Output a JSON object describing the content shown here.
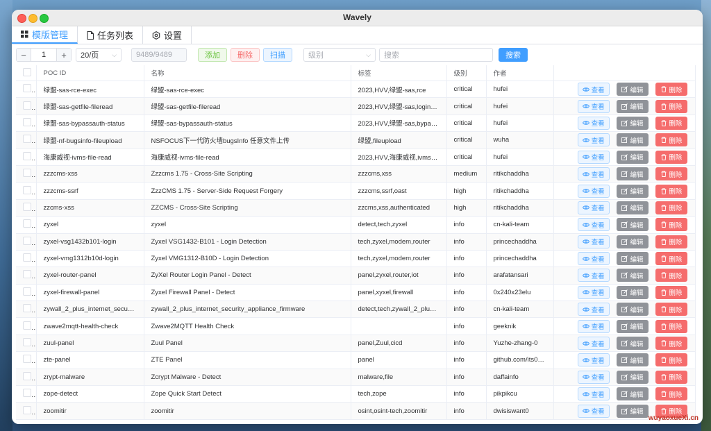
{
  "window": {
    "title": "Wavely"
  },
  "tabs": [
    {
      "label": "模版管理",
      "icon": "grid-icon"
    },
    {
      "label": "任务列表",
      "icon": "document-icon"
    },
    {
      "label": "设置",
      "icon": "gear-icon"
    }
  ],
  "toolbar": {
    "page_value": "1",
    "page_size": "20/页",
    "count_text": "9489/9489",
    "add_label": "添加",
    "delete_label": "删除",
    "scan_label": "扫描",
    "level_placeholder": "级别",
    "search_placeholder": "搜索",
    "search_label": "搜索"
  },
  "table": {
    "headers": [
      "POC ID",
      "名称",
      "标签",
      "级别",
      "作者"
    ],
    "actions": {
      "view": "查看",
      "edit": "编辑",
      "delete": "删除"
    },
    "rows": [
      [
        "绿盟-sas-rce-exec",
        "绿盟-sas-rce-exec",
        "2023,HVV,绿盟-sas,rce",
        "critical",
        "hufei"
      ],
      [
        "绿盟-sas-getfile-fileread",
        "绿盟-sas-getfile-fileread",
        "2023,HVV,绿盟-sas,login-b...",
        "critical",
        "hufei"
      ],
      [
        "绿盟-sas-bypassauth-status",
        "绿盟-sas-bypassauth-status",
        "2023,HVV,绿盟-sas,bypass...",
        "critical",
        "hufei"
      ],
      [
        "绿盟-nf-bugsinfo-fileupload",
        "NSFOCUS下一代防火墙bugsInfo 任意文件上传",
        "绿盟,fileupload",
        "critical",
        "wuha"
      ],
      [
        "海康威视-ivms-file-read",
        "海康威视-ivms-file-read",
        "2023,HVV,海康威视,ivms,read",
        "critical",
        "hufei"
      ],
      [
        "zzzcms-xss",
        "Zzzcms 1.75 - Cross-Site Scripting",
        "zzzcms,xss",
        "medium",
        "ritikchaddha"
      ],
      [
        "zzzcms-ssrf",
        "ZzzCMS 1.75 - Server-Side Request Forgery",
        "zzzcms,ssrf,oast",
        "high",
        "ritikchaddha"
      ],
      [
        "zzcms-xss",
        "ZZCMS - Cross-Site Scripting",
        "zzcms,xss,authenticated",
        "high",
        "ritikchaddha"
      ],
      [
        "zyxel",
        "zyxel",
        "detect,tech,zyxel",
        "info",
        "cn-kali-team"
      ],
      [
        "zyxel-vsg1432b101-login",
        "Zyxel VSG1432-B101 - Login Detection",
        "tech,zyxel,modem,router",
        "info",
        "princechaddha"
      ],
      [
        "zyxel-vmg1312b10d-login",
        "Zyxel VMG1312-B10D - Login Detection",
        "tech,zyxel,modem,router",
        "info",
        "princechaddha"
      ],
      [
        "zyxel-router-panel",
        "ZyXel Router Login Panel - Detect",
        "panel,zyxel,router,iot",
        "info",
        "arafatansari"
      ],
      [
        "zyxel-firewall-panel",
        "Zyxel Firewall Panel - Detect",
        "panel,xyxel,firewall",
        "info",
        "0x240x23elu"
      ],
      [
        "zywall_2_plus_internet_securit...",
        "zywall_2_plus_internet_security_appliance_firmware",
        "detect,tech,zywall_2_plus_...",
        "info",
        "cn-kali-team"
      ],
      [
        "zwave2mqtt-health-check",
        "Zwave2MQTT Health Check",
        "",
        "info",
        "geeknik"
      ],
      [
        "zuul-panel",
        "Zuul Panel",
        "panel,Zuul,cicd",
        "info",
        "Yuzhe-zhang-0"
      ],
      [
        "zte-panel",
        "ZTE Panel",
        "panel",
        "info",
        "github.com/its0x..."
      ],
      [
        "zrypt-malware",
        "Zcrypt Malware - Detect",
        "malware,file",
        "info",
        "daffainfo"
      ],
      [
        "zope-detect",
        "Zope Quick Start Detect",
        "tech,zope",
        "info",
        "pikpikcu"
      ],
      [
        "zoomitir",
        "zoomitir",
        "osint,osint-tech,zoomitir",
        "info",
        "dwisiswant0"
      ]
    ]
  },
  "watermark": "wuyaoxueXi.cn"
}
